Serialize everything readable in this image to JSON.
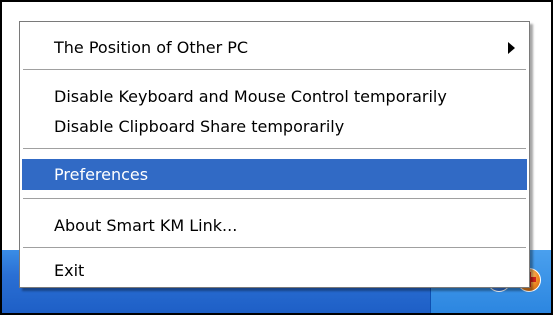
{
  "context_menu": {
    "items": [
      {
        "label": "The Position of Other PC",
        "has_submenu": true
      },
      {
        "label": "Disable Keyboard and Mouse Control temporarily"
      },
      {
        "label": "Disable Clipboard Share temporarily"
      },
      {
        "label": "Preferences",
        "selected": true
      },
      {
        "label": "About Smart KM Link..."
      },
      {
        "label": "Exit"
      }
    ]
  },
  "taskbar": {
    "tray_icons": [
      "keyboard-icon",
      "network-globe-icon",
      "security-shield-icon"
    ]
  },
  "colors": {
    "selection": "#316ac5",
    "taskbar": "#2a6fd4"
  }
}
